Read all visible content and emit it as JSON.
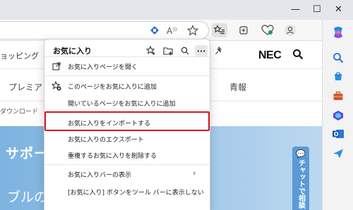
{
  "browser": {
    "window_controls": {
      "minimize": "—",
      "maximize": "☐",
      "close": "✕"
    },
    "toolbar": {
      "icons": [
        "translate-icon",
        "read-aloud-icon",
        "favorite-star-icon",
        "favorites-icon",
        "collections-icon",
        "browser-essentials-icon",
        "profile-icon",
        "copilot-icon"
      ]
    },
    "sidebar_icons": [
      "search-icon",
      "shopping-icon",
      "tools-icon",
      "office-icon",
      "outlook-icon",
      "send-icon"
    ]
  },
  "page": {
    "nav_text": "ョッピング",
    "logo": "NEC",
    "menu_item": "プレミア",
    "info_item": "青報",
    "breadcrumb": "ダウンロード",
    "hero_title": "サポー",
    "hero_sub": "ブルの対",
    "hero_dash": "—",
    "chat_tab": "チャットで相談",
    "chat_bubble": "💬"
  },
  "favorites_panel": {
    "title": "お気に入り",
    "header_icons": [
      "add-favorite-icon",
      "add-folder-icon",
      "search-favorites-icon",
      "more-options-icon",
      "pin-icon"
    ],
    "more_label": "···",
    "items": [
      {
        "label": "お気に入りページを開く",
        "icon": "open-external-icon"
      },
      {
        "label": "このページをお気に入りに追加",
        "icon": "add-favorite-icon"
      },
      {
        "label": "開いているページをお気に入りに追加",
        "icon": ""
      },
      {
        "label": "お気に入りをインポートする",
        "icon": ""
      },
      {
        "label": "お気に入りのエクスポート",
        "icon": ""
      },
      {
        "label": "重複するお気に入りを削除する",
        "icon": ""
      },
      {
        "label": "お気に入りバーの表示",
        "icon": "",
        "chevron": "›"
      },
      {
        "label": "[お気に入り] ボタンをツール バーに表示しない",
        "icon": ""
      }
    ]
  },
  "colors": {
    "highlight": "#d9151f",
    "edge_blue": "#1a73e8"
  }
}
